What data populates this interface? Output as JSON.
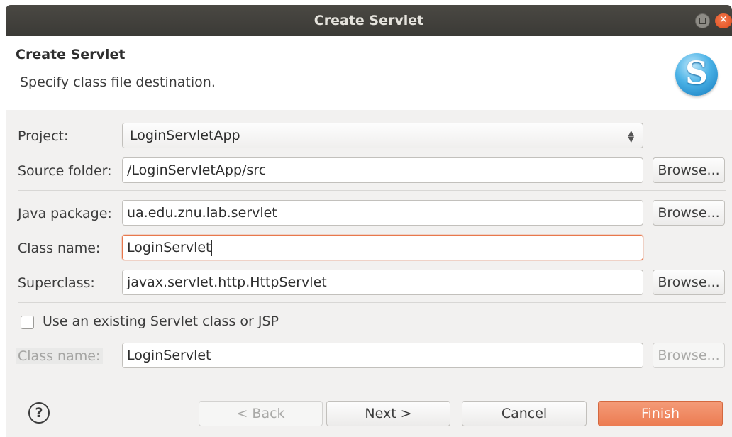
{
  "window": {
    "title": "Create Servlet"
  },
  "header": {
    "title": "Create Servlet",
    "description": "Specify class file destination.",
    "logo_letter": "S"
  },
  "form": {
    "project_label": "Project:",
    "project_value": "LoginServletApp",
    "source_folder_label": "Source folder:",
    "source_folder_value": "/LoginServletApp/src",
    "java_package_label": "Java package:",
    "java_package_value": "ua.edu.znu.lab.servlet",
    "class_name_label": "Class name:",
    "class_name_value": "LoginServlet",
    "superclass_label": "Superclass:",
    "superclass_value": "javax.servlet.http.HttpServlet",
    "browse_label": "Browse...",
    "existing_checkbox_label": "Use an existing Servlet class or JSP",
    "existing_checkbox_checked": false,
    "existing_class_label": "Class name:",
    "existing_class_value": "LoginServlet"
  },
  "footer": {
    "help_icon": "?",
    "back_label": "< Back",
    "next_label": "Next >",
    "cancel_label": "Cancel",
    "finish_label": "Finish"
  },
  "colors": {
    "accent": "#ec7c52",
    "titlebar": "#3b3a36",
    "body_bg": "#f2f1f0"
  }
}
